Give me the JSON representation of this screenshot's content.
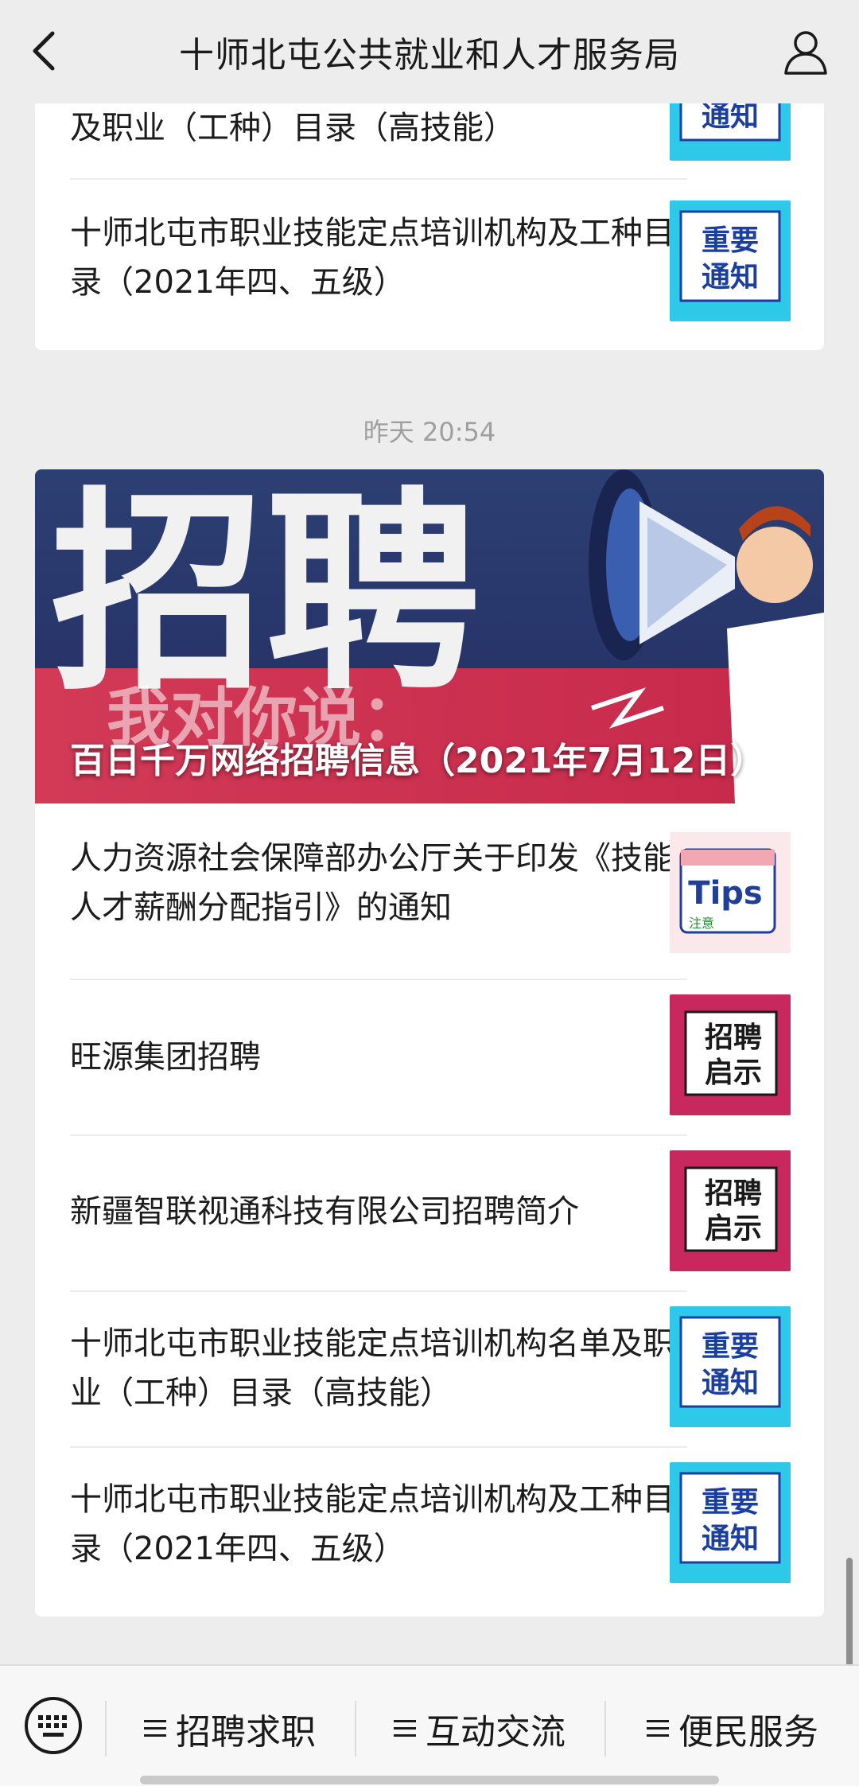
{
  "header": {
    "title": "十师北屯公共就业和人才服务局"
  },
  "top_card": {
    "items": [
      {
        "title": "及职业（工种）目录（高技能）",
        "thumb": "notice"
      },
      {
        "title": "十师北屯市职业技能定点培训机构及工种目录（2021年四、五级）",
        "thumb": "notice"
      }
    ]
  },
  "timestamp": "昨天 20:54",
  "main_card": {
    "banner": {
      "caption": "百日千万网络招聘信息（2021年7月12日）",
      "image_text": [
        "招聘",
        "我对你说："
      ]
    },
    "items": [
      {
        "title": "人力资源社会保障部办公厅关于印发《技能人才薪酬分配指引》的通知",
        "thumb": "tips"
      },
      {
        "title": "旺源集团招聘",
        "thumb": "recruit"
      },
      {
        "title": "新疆智联视通科技有限公司招聘简介",
        "thumb": "recruit"
      },
      {
        "title": "十师北屯市职业技能定点培训机构名单及职业（工种）目录（高技能）",
        "thumb": "notice"
      },
      {
        "title": "十师北屯市职业技能定点培训机构及工种目录（2021年四、五级）",
        "thumb": "notice"
      }
    ]
  },
  "thumbs": {
    "notice": {
      "line1": "重要",
      "line2": "通知",
      "bg": "#2ec9e8",
      "accent": "#1a3fa0"
    },
    "tips": {
      "main": "Tips",
      "sub": "注意",
      "bg": "#fbe8ea",
      "accent": "#1f3f9a"
    },
    "recruit": {
      "line1": "招聘",
      "line2": "启示",
      "bg": "#c8285e",
      "accent": "#1a1a1a"
    }
  },
  "bottom_menu": {
    "items": [
      "招聘求职",
      "互动交流",
      "便民服务"
    ]
  },
  "colors": {
    "background": "#ededed",
    "card": "#ffffff",
    "timestamp": "#9f9f9f"
  }
}
